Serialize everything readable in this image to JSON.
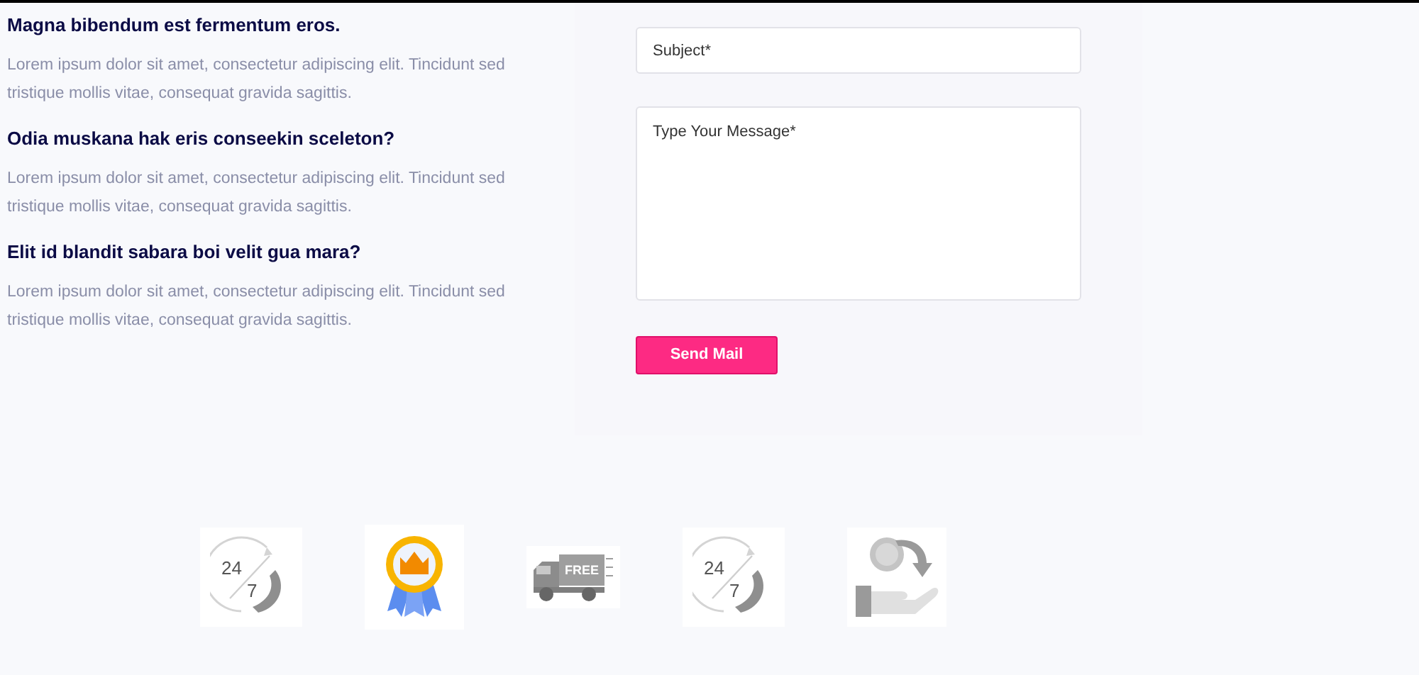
{
  "faq": [
    {
      "question": "Magna bibendum est fermentum eros.",
      "answer": "Lorem ipsum dolor sit amet, consectetur adipiscing elit. Tincidunt sed tristique mollis vitae, consequat gravida sagittis."
    },
    {
      "question": "Odia muskana hak eris conseekin sceleton?",
      "answer": "Lorem ipsum dolor sit amet, consectetur adipiscing elit. Tincidunt sed tristique mollis vitae, consequat gravida sagittis."
    },
    {
      "question": "Elit id blandit sabara boi velit gua mara?",
      "answer": "Lorem ipsum dolor sit amet, consectetur adipiscing elit. Tincidunt sed tristique mollis vitae, consequat gravida sagittis."
    }
  ],
  "form": {
    "subject": {
      "placeholder": "Subject*"
    },
    "message": {
      "placeholder": "Type Your Message*"
    },
    "submit": "Send Mail"
  },
  "features": [
    {
      "kind": "clock",
      "texts": [
        "24",
        "7"
      ]
    },
    {
      "kind": "medal"
    },
    {
      "kind": "truck",
      "texts": [
        "FREE"
      ]
    },
    {
      "kind": "clock",
      "texts": [
        "24",
        "7"
      ]
    },
    {
      "kind": "money"
    }
  ]
}
